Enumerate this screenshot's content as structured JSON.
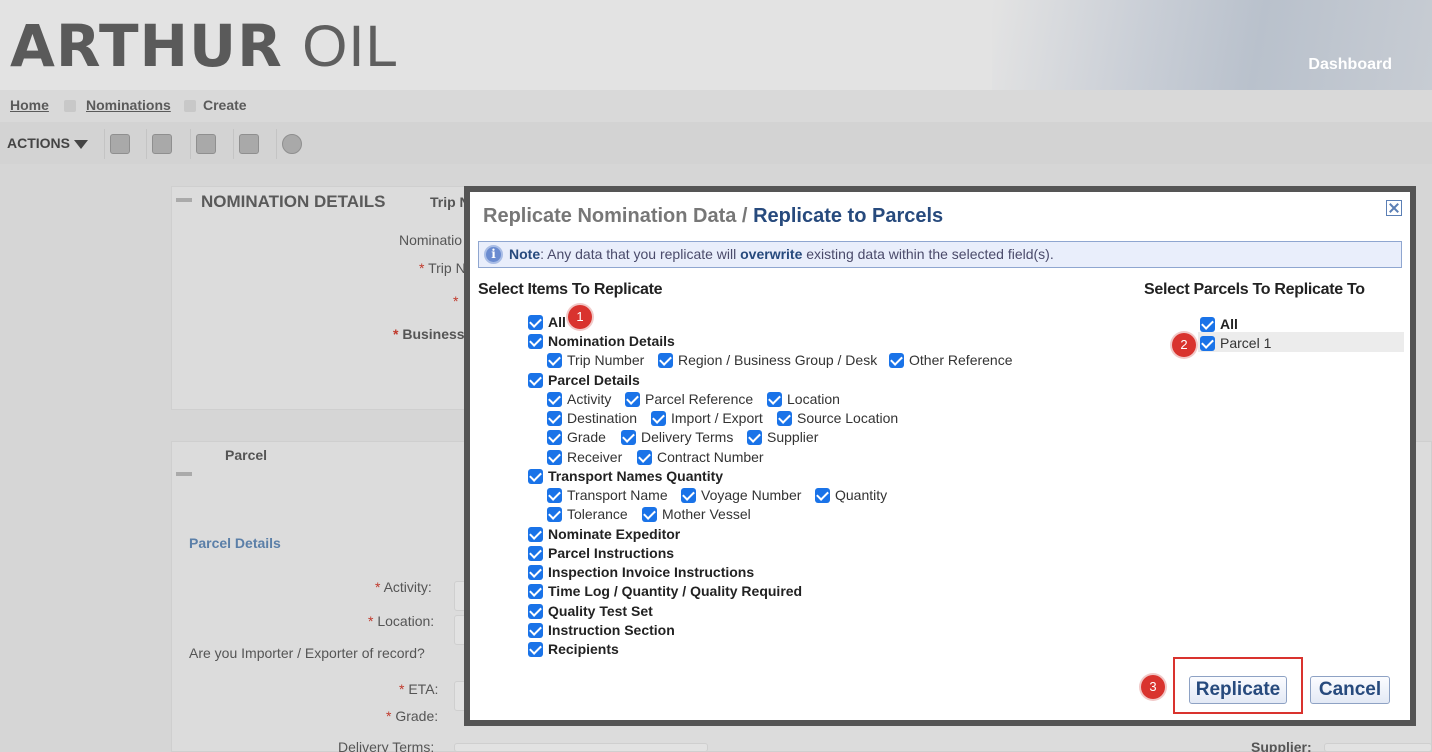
{
  "header": {
    "logo_bold": "ARTHUR",
    "logo_light": "OIL",
    "dashboard_label": "Dashboard"
  },
  "breadcrumb": {
    "items": [
      "Home",
      "Nominations",
      "Create"
    ]
  },
  "toolbar": {
    "actions_label": "ACTIONS",
    "icons": [
      "replicate-icon",
      "save-icon",
      "save-copy-icon",
      "save-submit-icon",
      "cancel-icon"
    ]
  },
  "background": {
    "section_title": "NOMINATION DETAILS",
    "trip_label": "Trip N",
    "nomination_label": "Nominatio",
    "trip_number_label": "Trip N",
    "business_label": "Business",
    "parcel_tab": "Parcel",
    "parcel_details": "Parcel Details",
    "activity_label": "Activity:",
    "location_label": "Location:",
    "importer_label": "Are you Importer / Exporter of record?",
    "eta_label": "ETA:",
    "grade_label": "Grade:",
    "delivery_terms_label": "Delivery Terms:",
    "supplier_label": "Supplier:",
    "required_mark": "*"
  },
  "modal": {
    "title_gray": "Replicate Nomination Data / ",
    "title_blue": "Replicate to Parcels",
    "note": {
      "label": "Note",
      "text_before": ": Any data that you replicate will ",
      "emphasis": "overwrite",
      "text_after": " existing data within the selected field(s).",
      "icon_glyph": "i"
    },
    "items_title": "Select Items To Replicate",
    "parcels_title": "Select Parcels To Replicate To",
    "items": {
      "all": "All",
      "nomination_details": "Nomination Details",
      "trip_number": "Trip Number",
      "region": "Region / Business Group / Desk",
      "other_reference": "Other Reference",
      "parcel_details": "Parcel Details",
      "activity": "Activity",
      "parcel_reference": "Parcel Reference",
      "location": "Location",
      "destination": "Destination",
      "import_export": "Import / Export",
      "source_location": "Source Location",
      "grade": "Grade",
      "delivery_terms": "Delivery Terms",
      "supplier": "Supplier",
      "receiver": "Receiver",
      "contract_number": "Contract Number",
      "transport": "Transport Names Quantity",
      "transport_name": "Transport Name",
      "voyage_number": "Voyage Number",
      "quantity": "Quantity",
      "tolerance": "Tolerance",
      "mother_vessel": "Mother Vessel",
      "nominate_expeditor": "Nominate Expeditor",
      "parcel_instructions": "Parcel Instructions",
      "inspection_invoice": "Inspection Invoice Instructions",
      "time_log": "Time Log / Quantity / Quality Required",
      "quality_test_set": "Quality Test Set",
      "instruction_section": "Instruction Section",
      "recipients": "Recipients"
    },
    "parcels": {
      "all": "All",
      "parcel_1": "Parcel 1"
    },
    "badges": [
      "1",
      "2",
      "3"
    ],
    "replicate_label": "Replicate",
    "cancel_label": "Cancel"
  },
  "colors": {
    "checkbox": "#1a73e8",
    "badge": "#d9332e",
    "title_blue": "#274a7d"
  }
}
